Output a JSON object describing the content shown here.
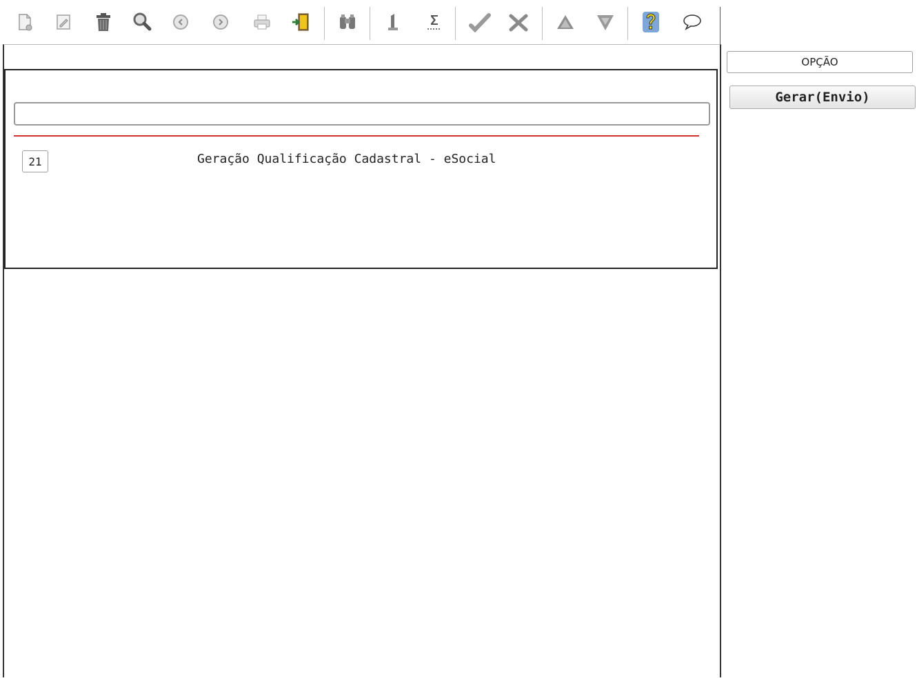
{
  "toolbar": {
    "buttons": [
      {
        "icon": "new-document-icon"
      },
      {
        "icon": "edit-icon"
      },
      {
        "icon": "delete-trash-icon"
      },
      {
        "icon": "search-magnifier-icon"
      },
      {
        "icon": "previous-arrow-icon"
      },
      {
        "icon": "next-arrow-icon"
      },
      {
        "icon": "print-icon"
      },
      {
        "icon": "exit-door-icon"
      },
      {
        "icon": "binoculars-icon"
      },
      {
        "icon": "info-icon"
      },
      {
        "icon": "sum-icon"
      },
      {
        "icon": "confirm-check-icon"
      },
      {
        "icon": "cancel-tools-icon"
      },
      {
        "icon": "sort-up-icon"
      },
      {
        "icon": "filter-down-icon"
      },
      {
        "icon": "help-question-icon"
      },
      {
        "icon": "comment-balloon-icon"
      }
    ]
  },
  "main": {
    "filter_value": "",
    "item": {
      "code": "21",
      "label": "Geração Qualificação Cadastral - eSocial"
    }
  },
  "right": {
    "option_label": "OPÇÃO",
    "generate_button": "Gerar(Envio)"
  },
  "colors": {
    "divider_red": "#d32f2f",
    "help_yellow": "#ffe600",
    "help_blue": "#7da7d9"
  }
}
